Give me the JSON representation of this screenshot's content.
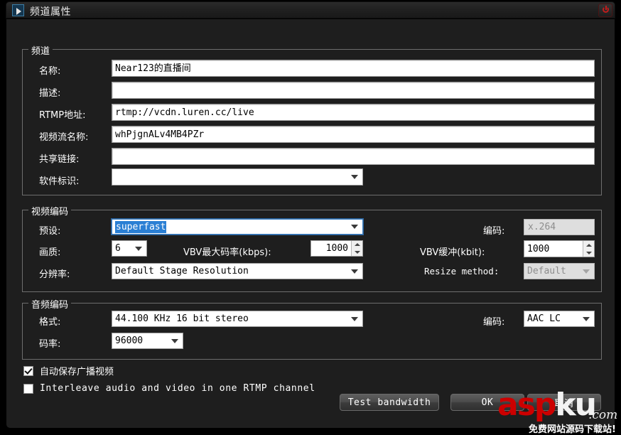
{
  "window": {
    "title": "频道属性",
    "app_icon": "video-play-icon",
    "close_icon": "power-close-icon"
  },
  "groups": {
    "channel": {
      "legend": "频道"
    },
    "video": {
      "legend": "视频编码"
    },
    "audio": {
      "legend": "音频编码"
    }
  },
  "channel": {
    "name_label": "名称:",
    "name_value": "Near123的直播间",
    "desc_label": "描述:",
    "desc_value": "",
    "rtmp_label": "RTMP地址:",
    "rtmp_value": "rtmp://vcdn.luren.cc/live",
    "stream_label": "视频流名称:",
    "stream_value": "whPjgnALv4MB4PZr",
    "share_label": "共享链接:",
    "share_value": "",
    "software_label": "软件标识:",
    "software_value": ""
  },
  "video": {
    "preset_label": "预设:",
    "preset_value": "superfast",
    "quality_label": "画质:",
    "quality_value": "6",
    "vbv_max_label": "VBV最大码率(kbps):",
    "vbv_max_value": "1000",
    "encoder_label": "编码:",
    "encoder_value": "x.264",
    "vbv_buf_label": "VBV缓冲(kbit):",
    "vbv_buf_value": "1000",
    "resolution_label": "分辨率:",
    "resolution_value": "Default Stage Resolution",
    "resize_label": "Resize method:",
    "resize_value": "Default"
  },
  "audio": {
    "format_label": "格式:",
    "format_value": "44.100 KHz 16 bit stereo",
    "bitrate_label": "码率:",
    "bitrate_value": "96000",
    "encoder_label": "编码:",
    "encoder_value": "AAC LC"
  },
  "options": {
    "autosave_label": "自动保存广播视频",
    "autosave_checked": true,
    "interleave_label": "Interleave audio and video in one RTMP channel",
    "interleave_checked": false
  },
  "buttons": {
    "test_bandwidth": "Test bandwidth",
    "ok": "OK",
    "cancel": "取消"
  },
  "watermark": {
    "part1": "asp",
    "part2": "ku",
    "domain": ".com",
    "tagline": "免费网站源码下载站!"
  },
  "colors": {
    "window_bg": "#1e1e1e",
    "accent_selection": "#2a7fd4",
    "close_red": "#c01c1c",
    "watermark_red": "#cc0000"
  }
}
